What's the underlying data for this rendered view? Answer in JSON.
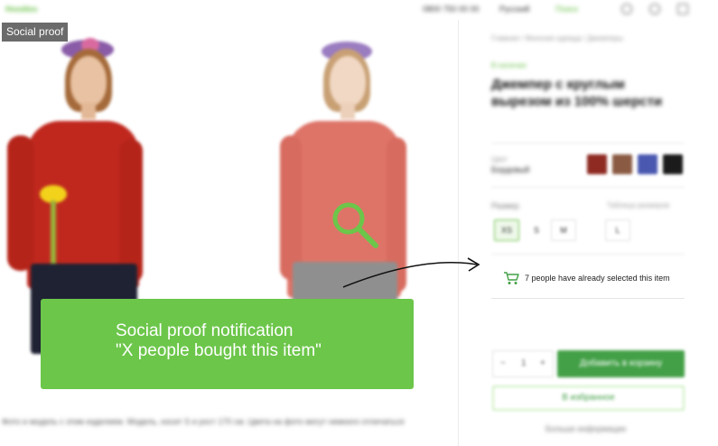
{
  "header": {
    "logo": "Hoodies",
    "phone": "0800 750 00 00",
    "language": "Русский",
    "search": "Поиск",
    "icons": [
      "user-icon",
      "heart-icon",
      "cart-icon"
    ]
  },
  "tag": {
    "label": "Social proof"
  },
  "banner": {
    "line1": "Social proof notification",
    "line2": "\"X people bought this item\""
  },
  "gallery": {
    "description": "Фото и модель с этим изделием. Модель, носит S и рост 170 см. Цвета на фото могут немного отличаться"
  },
  "product": {
    "breadcrumbs": "Главная / Женская одежда / Джемперы",
    "stock": "В наличии",
    "title": "Джемпер с круглым вырезом из 100% шерсти",
    "color_label": "Цвет",
    "color_value": "Бордовый",
    "swatches": [
      "#8e2a22",
      "#8a5a43",
      "#4a58b0",
      "#1b1b1b"
    ],
    "size_label": "Размер",
    "size_guide": "Таблица размеров",
    "sizes": [
      "XS",
      "S",
      "M",
      "L"
    ],
    "social_proof": "7 people have already selected this item",
    "qty_minus": "−",
    "qty_value": "1",
    "qty_plus": "+",
    "add_to_cart": "Добавить в корзину",
    "favorite": "В избранное",
    "more_link": "Больше информации"
  },
  "colors": {
    "accent": "#6cc64a",
    "button": "#43a047",
    "tag_bg": "#6b6b6b"
  }
}
